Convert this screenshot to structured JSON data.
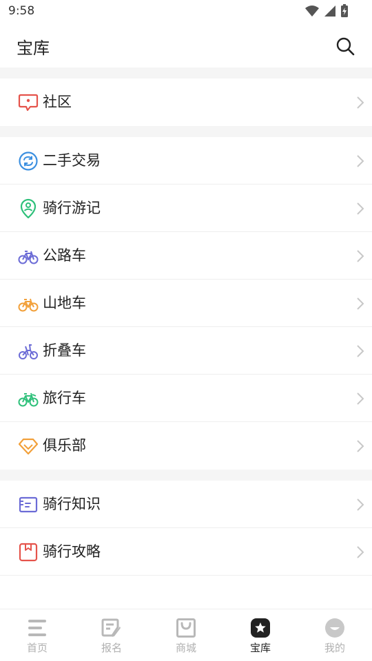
{
  "status_bar": {
    "time": "9:58"
  },
  "header": {
    "title": "宝库"
  },
  "items": {
    "community": "社区",
    "used": "二手交易",
    "travelogue": "骑行游记",
    "road": "公路车",
    "mtb": "山地车",
    "folding": "折叠车",
    "touring": "旅行车",
    "club": "俱乐部",
    "knowledge": "骑行知识",
    "guide": "骑行攻略"
  },
  "tabs": {
    "home": "首页",
    "signup": "报名",
    "mall": "商城",
    "treasure": "宝库",
    "mine": "我的"
  },
  "colors": {
    "red": "#e5534b",
    "blue": "#3b8fe0",
    "green": "#2ec07a",
    "purple": "#6b6bd6",
    "orange": "#f2a03a",
    "tab_active": "#222222",
    "tab_inactive": "#b0b0b0"
  }
}
